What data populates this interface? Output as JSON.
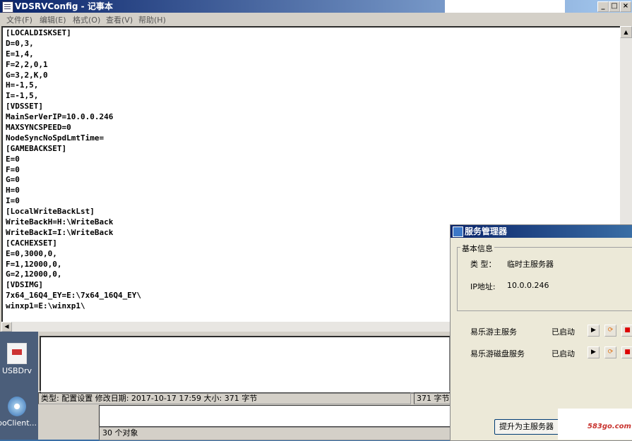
{
  "notepad": {
    "title": "VDSRVConfig - 记事本",
    "menu": [
      "文件(F)",
      "编辑(E)",
      "格式(O)",
      "查看(V)",
      "帮助(H)"
    ],
    "window_buttons": {
      "minimize": "_",
      "maximize": "□",
      "close": "×"
    },
    "lines": [
      "[LOCALDISKSET]",
      "D=0,3,",
      "E=1,4,",
      "F=2,2,0,1",
      "G=3,2,K,0",
      "H=-1,5,",
      "I=-1,5,",
      "[VDSSET]",
      "MainSerVerIP=10.0.0.246",
      "MAXSYNCSPEED=0",
      "NodeSyncNoSpdLmtTime=",
      "[GAMEBACKSET]",
      "E=0",
      "F=0",
      "G=0",
      "H=0",
      "I=0",
      "[LocalWriteBackLst]",
      "WriteBackH=H:\\WriteBack",
      "WriteBackI=I:\\WriteBack",
      "[CACHEXSET]",
      "E=0,3000,0,",
      "F=1,12000,0,",
      "G=2,12000,0,",
      "[VDSIMG]",
      "7x64_16Q4_EY=E:\\7x64_16Q4_EY\\",
      "winxp1=E:\\winxp1\\"
    ]
  },
  "desktop": {
    "icons": [
      {
        "label": "USBDrv",
        "icon": "usb-driver-icon"
      },
      {
        "label": "boClient...",
        "icon": "disc-icon"
      }
    ]
  },
  "explorer": {
    "status_info": "类型: 配置设置 修改日期: 2017-10-17 17:59 大小: 371 字节",
    "status_size": "371 字节",
    "object_count": "30 个对象"
  },
  "service_manager": {
    "title": "服务管理器",
    "group_label": "基本信息",
    "type_label": "类 型：",
    "type_value": "临时主服务器",
    "ip_label": "IP地址:",
    "ip_value": "10.0.0.246",
    "services": [
      {
        "name": "易乐游主服务",
        "status": "已启动"
      },
      {
        "name": "易乐游磁盘服务",
        "status": "已启动"
      }
    ],
    "promote_button": "提升为主服务器"
  },
  "watermark": {
    "text": "583go.com"
  }
}
